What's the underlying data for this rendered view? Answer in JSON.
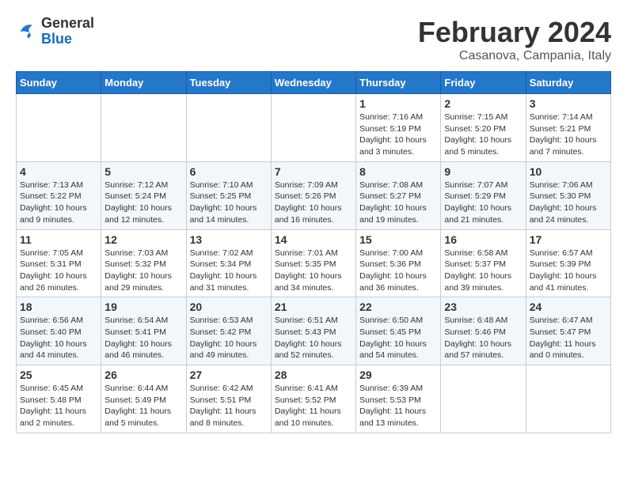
{
  "header": {
    "logo_general": "General",
    "logo_blue": "Blue",
    "title": "February 2024",
    "subtitle": "Casanova, Campania, Italy"
  },
  "days_of_week": [
    "Sunday",
    "Monday",
    "Tuesday",
    "Wednesday",
    "Thursday",
    "Friday",
    "Saturday"
  ],
  "weeks": [
    [
      {
        "day": "",
        "info": ""
      },
      {
        "day": "",
        "info": ""
      },
      {
        "day": "",
        "info": ""
      },
      {
        "day": "",
        "info": ""
      },
      {
        "day": "1",
        "info": "Sunrise: 7:16 AM\nSunset: 5:19 PM\nDaylight: 10 hours\nand 3 minutes."
      },
      {
        "day": "2",
        "info": "Sunrise: 7:15 AM\nSunset: 5:20 PM\nDaylight: 10 hours\nand 5 minutes."
      },
      {
        "day": "3",
        "info": "Sunrise: 7:14 AM\nSunset: 5:21 PM\nDaylight: 10 hours\nand 7 minutes."
      }
    ],
    [
      {
        "day": "4",
        "info": "Sunrise: 7:13 AM\nSunset: 5:22 PM\nDaylight: 10 hours\nand 9 minutes."
      },
      {
        "day": "5",
        "info": "Sunrise: 7:12 AM\nSunset: 5:24 PM\nDaylight: 10 hours\nand 12 minutes."
      },
      {
        "day": "6",
        "info": "Sunrise: 7:10 AM\nSunset: 5:25 PM\nDaylight: 10 hours\nand 14 minutes."
      },
      {
        "day": "7",
        "info": "Sunrise: 7:09 AM\nSunset: 5:26 PM\nDaylight: 10 hours\nand 16 minutes."
      },
      {
        "day": "8",
        "info": "Sunrise: 7:08 AM\nSunset: 5:27 PM\nDaylight: 10 hours\nand 19 minutes."
      },
      {
        "day": "9",
        "info": "Sunrise: 7:07 AM\nSunset: 5:29 PM\nDaylight: 10 hours\nand 21 minutes."
      },
      {
        "day": "10",
        "info": "Sunrise: 7:06 AM\nSunset: 5:30 PM\nDaylight: 10 hours\nand 24 minutes."
      }
    ],
    [
      {
        "day": "11",
        "info": "Sunrise: 7:05 AM\nSunset: 5:31 PM\nDaylight: 10 hours\nand 26 minutes."
      },
      {
        "day": "12",
        "info": "Sunrise: 7:03 AM\nSunset: 5:32 PM\nDaylight: 10 hours\nand 29 minutes."
      },
      {
        "day": "13",
        "info": "Sunrise: 7:02 AM\nSunset: 5:34 PM\nDaylight: 10 hours\nand 31 minutes."
      },
      {
        "day": "14",
        "info": "Sunrise: 7:01 AM\nSunset: 5:35 PM\nDaylight: 10 hours\nand 34 minutes."
      },
      {
        "day": "15",
        "info": "Sunrise: 7:00 AM\nSunset: 5:36 PM\nDaylight: 10 hours\nand 36 minutes."
      },
      {
        "day": "16",
        "info": "Sunrise: 6:58 AM\nSunset: 5:37 PM\nDaylight: 10 hours\nand 39 minutes."
      },
      {
        "day": "17",
        "info": "Sunrise: 6:57 AM\nSunset: 5:39 PM\nDaylight: 10 hours\nand 41 minutes."
      }
    ],
    [
      {
        "day": "18",
        "info": "Sunrise: 6:56 AM\nSunset: 5:40 PM\nDaylight: 10 hours\nand 44 minutes."
      },
      {
        "day": "19",
        "info": "Sunrise: 6:54 AM\nSunset: 5:41 PM\nDaylight: 10 hours\nand 46 minutes."
      },
      {
        "day": "20",
        "info": "Sunrise: 6:53 AM\nSunset: 5:42 PM\nDaylight: 10 hours\nand 49 minutes."
      },
      {
        "day": "21",
        "info": "Sunrise: 6:51 AM\nSunset: 5:43 PM\nDaylight: 10 hours\nand 52 minutes."
      },
      {
        "day": "22",
        "info": "Sunrise: 6:50 AM\nSunset: 5:45 PM\nDaylight: 10 hours\nand 54 minutes."
      },
      {
        "day": "23",
        "info": "Sunrise: 6:48 AM\nSunset: 5:46 PM\nDaylight: 10 hours\nand 57 minutes."
      },
      {
        "day": "24",
        "info": "Sunrise: 6:47 AM\nSunset: 5:47 PM\nDaylight: 11 hours\nand 0 minutes."
      }
    ],
    [
      {
        "day": "25",
        "info": "Sunrise: 6:45 AM\nSunset: 5:48 PM\nDaylight: 11 hours\nand 2 minutes."
      },
      {
        "day": "26",
        "info": "Sunrise: 6:44 AM\nSunset: 5:49 PM\nDaylight: 11 hours\nand 5 minutes."
      },
      {
        "day": "27",
        "info": "Sunrise: 6:42 AM\nSunset: 5:51 PM\nDaylight: 11 hours\nand 8 minutes."
      },
      {
        "day": "28",
        "info": "Sunrise: 6:41 AM\nSunset: 5:52 PM\nDaylight: 11 hours\nand 10 minutes."
      },
      {
        "day": "29",
        "info": "Sunrise: 6:39 AM\nSunset: 5:53 PM\nDaylight: 11 hours\nand 13 minutes."
      },
      {
        "day": "",
        "info": ""
      },
      {
        "day": "",
        "info": ""
      }
    ]
  ]
}
